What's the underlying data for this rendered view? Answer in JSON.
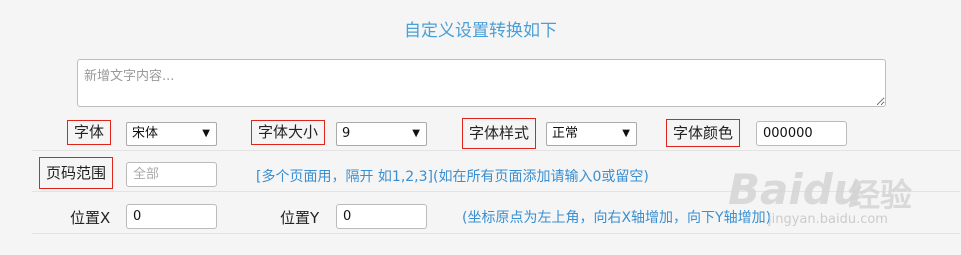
{
  "header": {
    "title": "自定义设置转换如下"
  },
  "content": {
    "placeholder": "新增文字内容..."
  },
  "font_row": {
    "font_label": "字体",
    "font_value": "宋体",
    "size_label": "字体大小",
    "size_value": "9",
    "style_label": "字体样式",
    "style_value": "正常",
    "color_label": "字体颜色",
    "color_value": "000000"
  },
  "page_row": {
    "label": "页码范围",
    "placeholder": "全部",
    "hint": "[多个页面用，隔开 如1,2,3](如在所有页面添加请输入0或留空)"
  },
  "position_row": {
    "x_label": "位置X",
    "x_value": "0",
    "y_label": "位置Y",
    "y_value": "0",
    "hint": "(坐标原点为左上角，向右X轴增加，向下Y轴增加)"
  },
  "watermark": {
    "brand": "Baidu",
    "brand_cn": "经验",
    "url": "jingyan.baidu.com"
  },
  "colors": {
    "accent": "#4a9fd6",
    "highlight_border": "#e0241c",
    "hint": "#3a8fd1"
  }
}
